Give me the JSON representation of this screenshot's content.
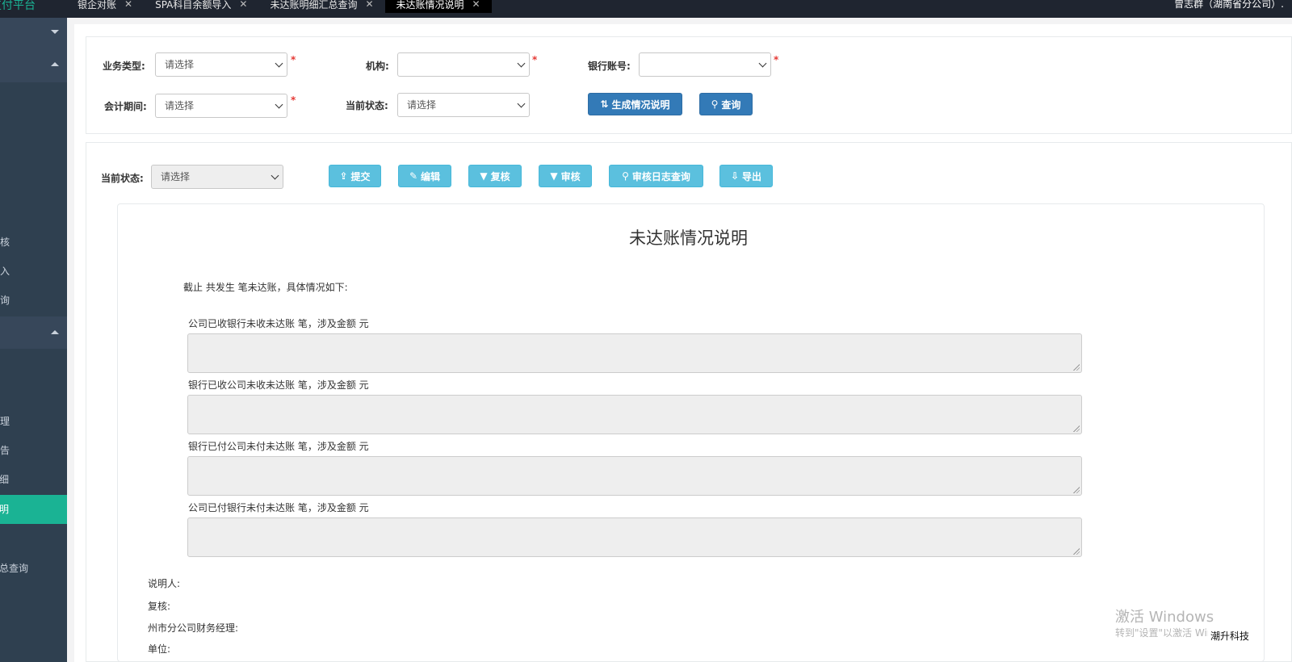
{
  "topbar": {
    "brand": "支付平台",
    "tabs": [
      {
        "label": "银企对账",
        "active": false
      },
      {
        "label": "SPA科目余额导入",
        "active": false
      },
      {
        "label": "未达账明细汇总查询",
        "active": false
      },
      {
        "label": "未达账情况说明",
        "active": true
      }
    ],
    "close_glyph": "✕",
    "user": "曾志群（湖南省分公司）."
  },
  "sidebar": {
    "items": [
      {
        "label": "审核",
        "active": false
      },
      {
        "label": "导入",
        "active": false
      },
      {
        "label": "查询",
        "active": false
      },
      {
        "label": "管理",
        "active": false
      },
      {
        "label": "报告",
        "active": false
      },
      {
        "label": "细",
        "active": false
      },
      {
        "label": "明",
        "active": true
      },
      {
        "label": "总查询",
        "active": false
      }
    ]
  },
  "filters": {
    "business_type": {
      "label": "业务类型:",
      "value": "请选择"
    },
    "org": {
      "label": "机构:",
      "value": ""
    },
    "bank_account": {
      "label": "银行账号:",
      "value": ""
    },
    "period": {
      "label": "会计期间:",
      "value": "请选择"
    },
    "status": {
      "label": "当前状态:",
      "value": "请选择"
    },
    "required_mark": "*",
    "generate_button": "生成情况说明",
    "query_button": "查询"
  },
  "toolbar": {
    "status_label": "当前状态:",
    "status_value": "请选择",
    "submit": "提交",
    "edit": "编辑",
    "recheck": "复核",
    "audit": "审核",
    "audit_log": "审核日志查询",
    "export": "导出"
  },
  "document": {
    "title": "未达账情况说明",
    "intro": "截止    共发生    笔未达账，具体情况如下:",
    "items": [
      "公司已收银行未收未达账    笔，涉及金额    元",
      "银行已收公司未收未达账    笔，涉及金额    元",
      "银行已付公司未付未达账    笔，涉及金额    元",
      "公司已付银行未付未达账    笔，涉及金额    元"
    ],
    "signers": [
      "说明人:",
      "复核:",
      "州市分公司财务经理:",
      "单位:"
    ]
  },
  "watermark": {
    "line1": "激活 Windows",
    "line2": "转到\"设置\"以激活 Windows。"
  },
  "corner_tag": "潮升科技"
}
